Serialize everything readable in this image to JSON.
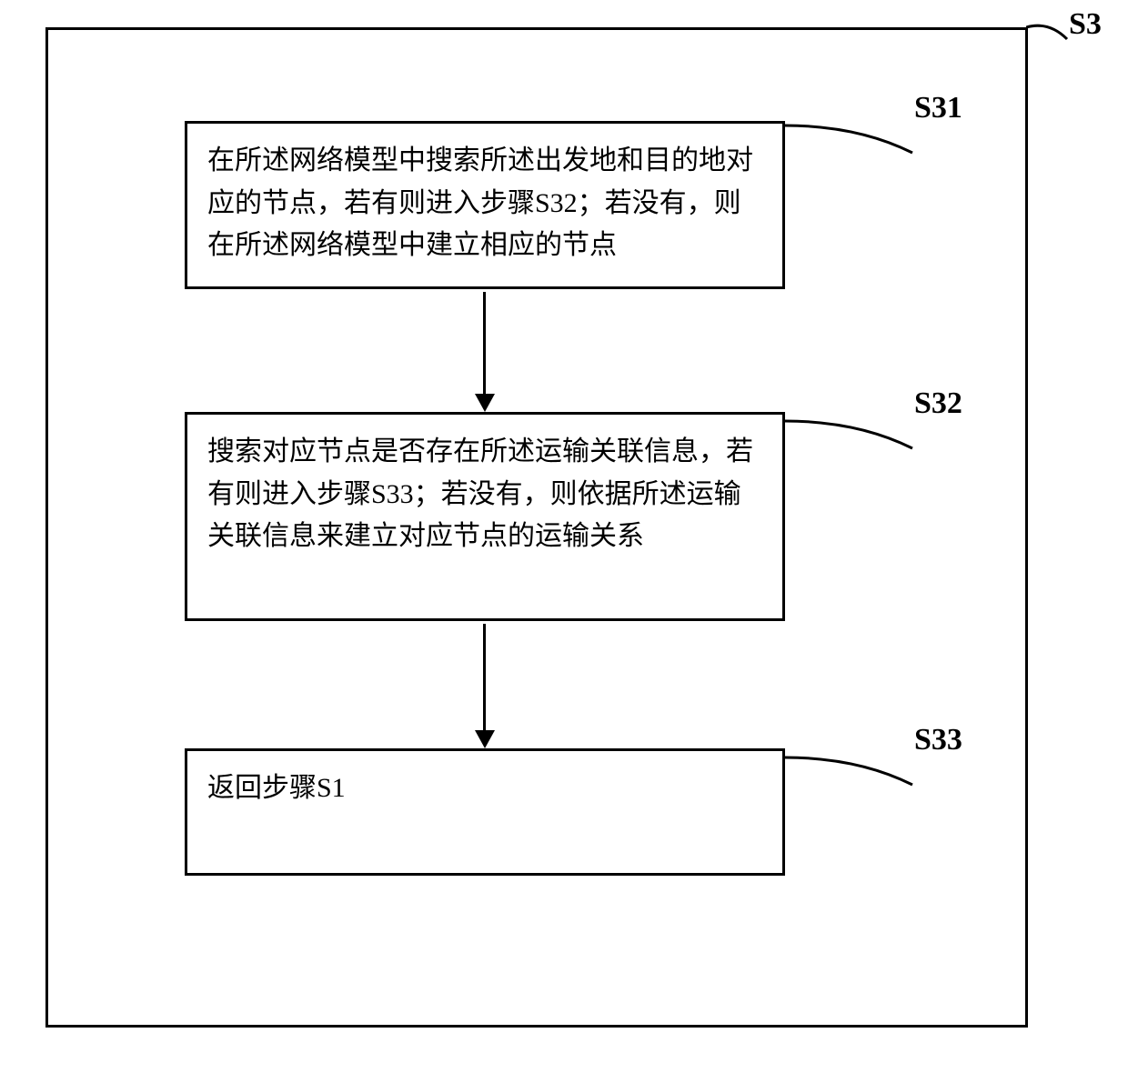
{
  "labels": {
    "s3": "S3",
    "s31": "S31",
    "s32": "S32",
    "s33": "S33"
  },
  "boxes": {
    "s31": "在所述网络模型中搜索所述出发地和目的地对应的节点，若有则进入步骤S32；若没有，则在所述网络模型中建立相应的节点",
    "s32": "搜索对应节点是否存在所述运输关联信息，若有则进入步骤S33；若没有，则依据所述运输关联信息来建立对应节点的运输关系",
    "s33": "返回步骤S1"
  }
}
